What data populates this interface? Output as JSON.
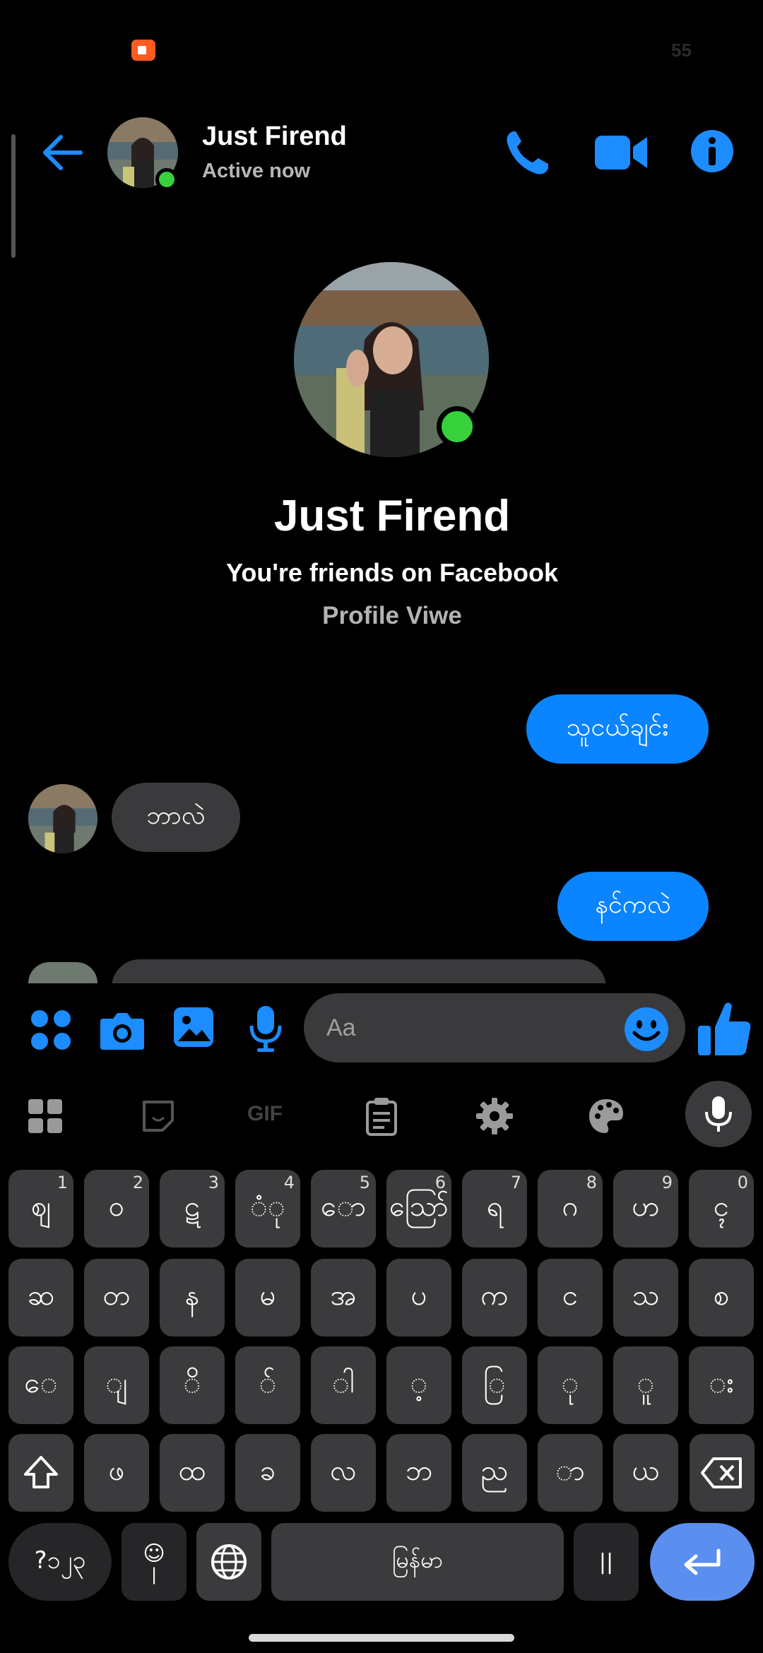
{
  "status_bar": {
    "right_text": "55"
  },
  "header": {
    "name": "Just Firend",
    "status": "Active now"
  },
  "profile": {
    "name": "Just Firend",
    "subtitle": "You're friends on Facebook",
    "link": "Profile Viwe"
  },
  "messages": [
    {
      "side": "out",
      "text": "သူငယ်ချင်း"
    },
    {
      "side": "in",
      "text": "ဘာလဲ"
    },
    {
      "side": "out",
      "text": "နင်ကလဲ"
    }
  ],
  "composer": {
    "placeholder": "Aa"
  },
  "keyboard": {
    "toolbar": [
      "apps-grid-icon",
      "sticker-icon",
      "gif-icon",
      "clipboard-icon",
      "settings-icon",
      "theme-palette-icon",
      "microphone-icon"
    ],
    "toolbar_gif_label": "GIF",
    "row1": [
      {
        "label": "ဈ",
        "hint": "1"
      },
      {
        "label": "ဝ",
        "hint": "2"
      },
      {
        "label": "ဋ",
        "hint": "3"
      },
      {
        "label": "ံု",
        "hint": "4"
      },
      {
        "label": "ော",
        "hint": "5"
      },
      {
        "label": "ဪ",
        "hint": "6"
      },
      {
        "label": "ရ",
        "hint": "7"
      },
      {
        "label": "ဂ",
        "hint": "8"
      },
      {
        "label": "ဟ",
        "hint": "9"
      },
      {
        "label": "ၚ",
        "hint": "0"
      }
    ],
    "row2": [
      "ဆ",
      "တ",
      "န",
      "မ",
      "အ",
      "ပ",
      "က",
      "င",
      "သ",
      "စ"
    ],
    "row3": [
      "ေ",
      "ျ",
      "ိ",
      "်",
      "ါ",
      "့",
      "ြ",
      "ု",
      "ူ",
      "း"
    ],
    "row4": [
      "ဖ",
      "ထ",
      "ခ",
      "လ",
      "ဘ",
      "ည",
      "ာ",
      "ယ"
    ],
    "bottom": {
      "symbols_label": "?၁၂၃",
      "emoji_label": "☺",
      "space_label": "မြန်မာ"
    }
  }
}
